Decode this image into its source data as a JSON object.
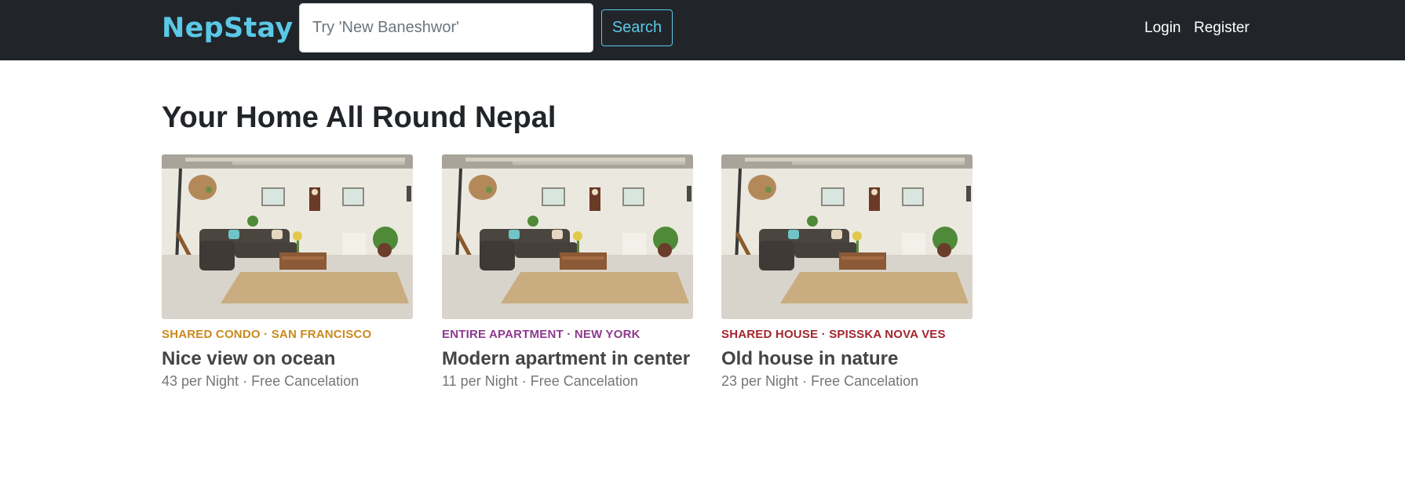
{
  "navbar": {
    "brand": "NepStay",
    "search_placeholder": "Try 'New Baneshwor'",
    "search_value": "",
    "search_label": "Search",
    "login_label": "Login",
    "register_label": "Register",
    "brand_color": "#5bc8e6",
    "background_color": "#212529"
  },
  "main": {
    "heading": "Your Home All Round Nepal",
    "listings": [
      {
        "type": "SHARED CONDO",
        "location": "SAN FRANCISCO",
        "separator": "·",
        "type_color": "#c98a1e",
        "title": "Nice view on ocean",
        "price": "43 per Night",
        "cancel": "Free Cancelation",
        "photo_icon": "living-room-photo"
      },
      {
        "type": "ENTIRE APARTMENT",
        "location": "NEW YORK",
        "separator": "·",
        "type_color": "#8e3a8e",
        "title": "Modern apartment in center",
        "price": "11 per Night",
        "cancel": "Free Cancelation",
        "photo_icon": "living-room-photo"
      },
      {
        "type": "SHARED HOUSE",
        "location": "SPISSKA NOVA VES",
        "separator": "·",
        "type_color": "#a3262f",
        "title": "Old house in nature",
        "price": "23 per Night",
        "cancel": "Free Cancelation",
        "photo_icon": "living-room-photo"
      }
    ]
  }
}
